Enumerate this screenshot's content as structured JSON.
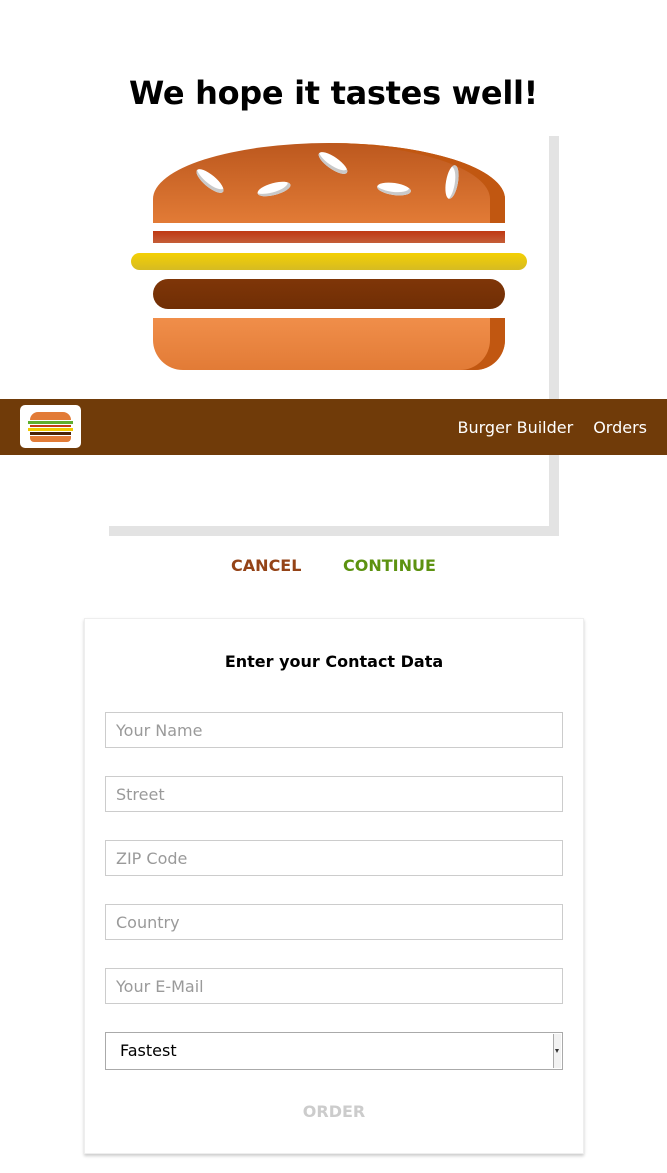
{
  "page": {
    "title": "We hope it tastes well!"
  },
  "toolbar": {
    "nav": [
      "Burger Builder",
      "Orders"
    ]
  },
  "actions": {
    "cancel_label": "CANCEL",
    "continue_label": "CONTINUE"
  },
  "form": {
    "title": "Enter your Contact Data",
    "fields": [
      {
        "placeholder": "Your Name"
      },
      {
        "placeholder": "Street"
      },
      {
        "placeholder": "ZIP Code"
      },
      {
        "placeholder": "Country"
      },
      {
        "placeholder": "Your E-Mail"
      }
    ],
    "delivery_method": "Fastest",
    "order_label": "ORDER"
  },
  "colors": {
    "toolbar_bg": "#703b09",
    "cancel": "#944317",
    "continue": "#5c9210",
    "disabled": "#cccccc"
  }
}
